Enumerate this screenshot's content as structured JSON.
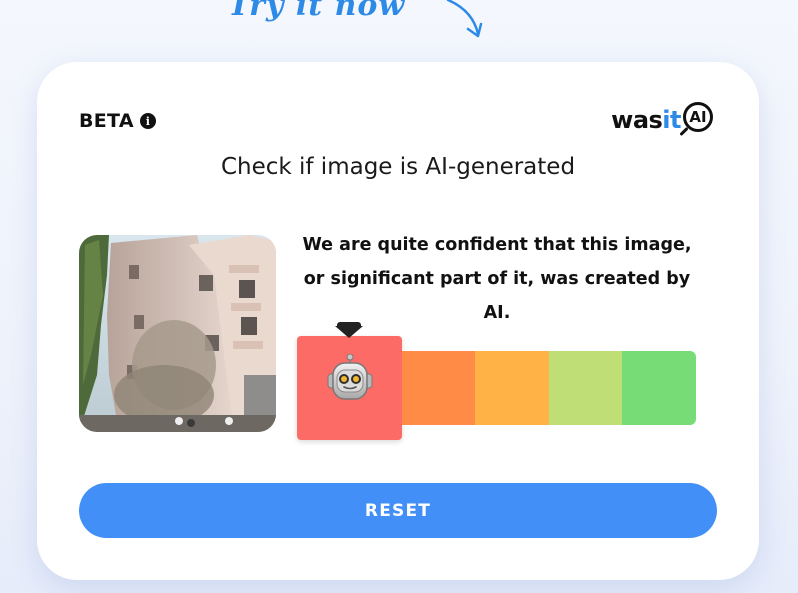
{
  "cta": {
    "text": "Try it now"
  },
  "card": {
    "beta_label": "BETA",
    "info_icon": "info-icon",
    "logo": {
      "part1": "was",
      "part2": "it",
      "part3": "AI"
    },
    "headline": "Check if image is AI-generated",
    "result_text": "We are quite confident that this image, or significant part of it, was created by AI.",
    "scale": {
      "selected_level": 1,
      "levels": 5,
      "colors": [
        "#fd6b67",
        "#ff8b47",
        "#ffb347",
        "#bfdf76",
        "#77dc76"
      ],
      "marker_icon": "robot-icon"
    },
    "reset_label": "RESET"
  }
}
